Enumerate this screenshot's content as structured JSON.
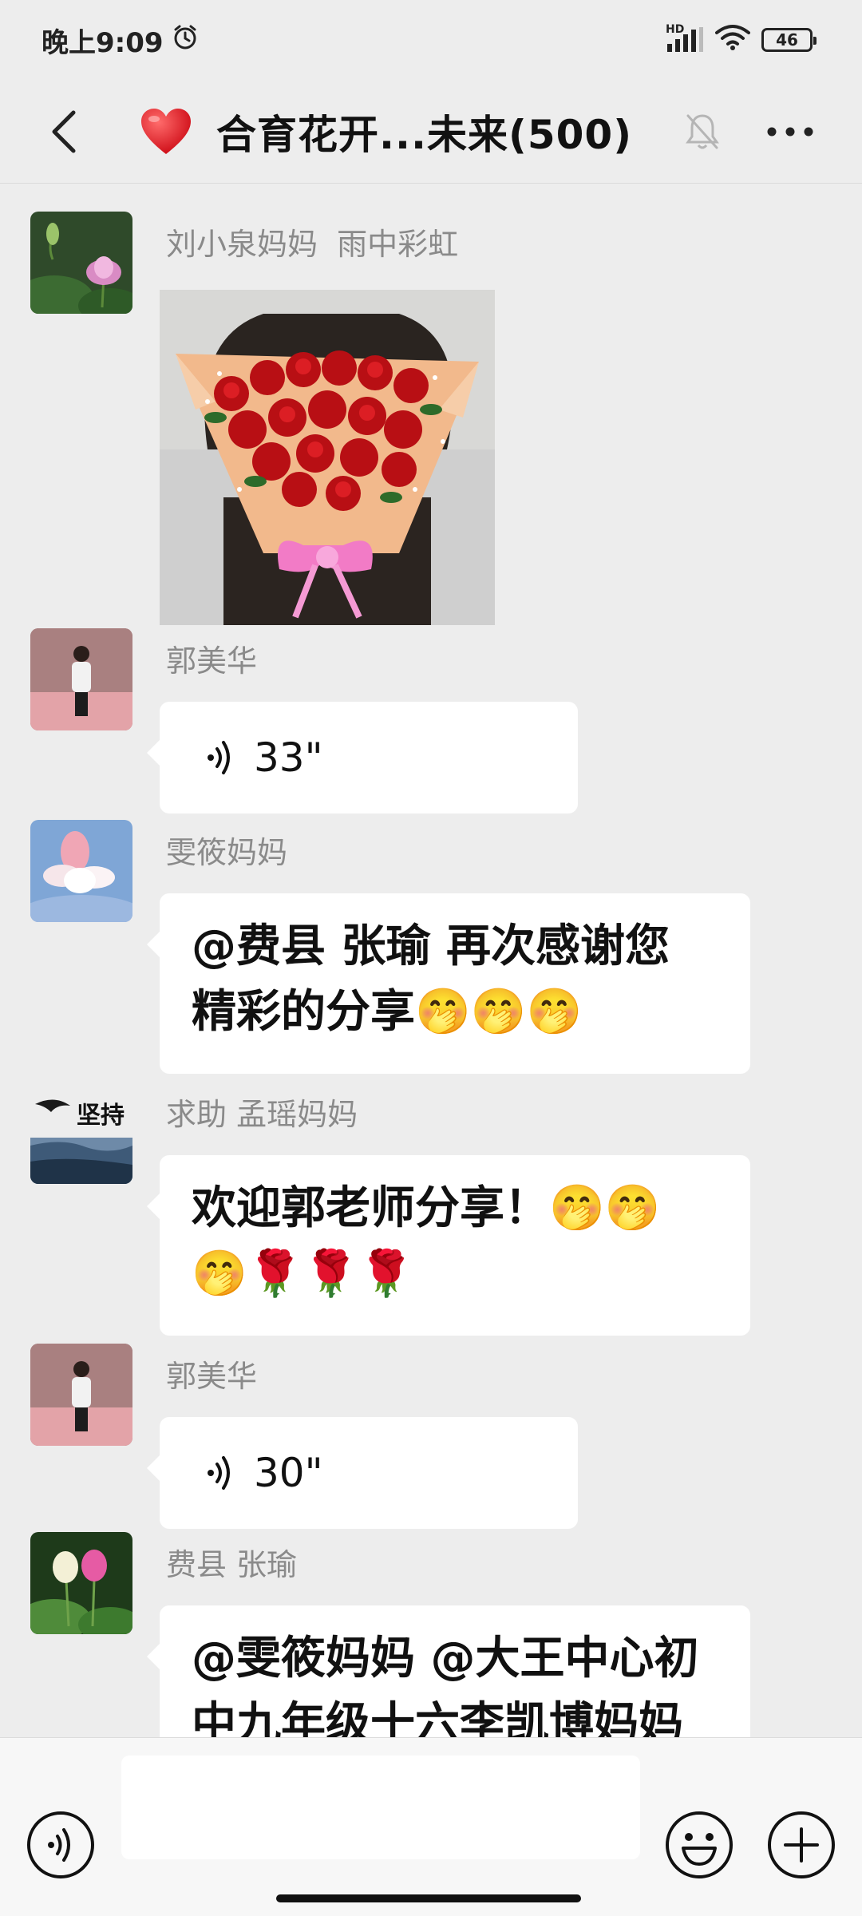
{
  "status_bar": {
    "time": "晚上9:09",
    "network": "HD",
    "battery": "46"
  },
  "header": {
    "title": "合育花开...未来(500)"
  },
  "messages": [
    {
      "sender": "刘小泉妈妈  雨中彩虹",
      "type": "image"
    },
    {
      "sender": "郭美华",
      "type": "voice",
      "duration": "33\""
    },
    {
      "sender": "雯筱妈妈",
      "type": "text",
      "line1": "@费县 张瑜  再次感谢您",
      "line2": "精彩的分享🤭🤭🤭"
    },
    {
      "sender": "求助 孟瑶妈妈",
      "type": "text",
      "line1": "欢迎郭老师分享！🤭🤭",
      "line2": "🤭🌹🌹🌹"
    },
    {
      "sender": "郭美华",
      "type": "voice",
      "duration": "30\""
    },
    {
      "sender": "费县 张瑜",
      "type": "text",
      "line1": "@雯筱妈妈 @大王中心初",
      "line2": "中九年级十六李凯博妈妈"
    }
  ],
  "avatar_labels": {
    "persist": "坚持"
  },
  "input_bar": {
    "placeholder": ""
  },
  "colors": {
    "background": "#EDEDED",
    "bubble": "#FFFFFF",
    "sender_name": "#8A8A8A"
  },
  "icons": [
    "back-arrow-icon",
    "heart-icon",
    "mute-bell-icon",
    "more-dots-icon",
    "voice-icon",
    "emoji-icon",
    "plus-icon"
  ]
}
